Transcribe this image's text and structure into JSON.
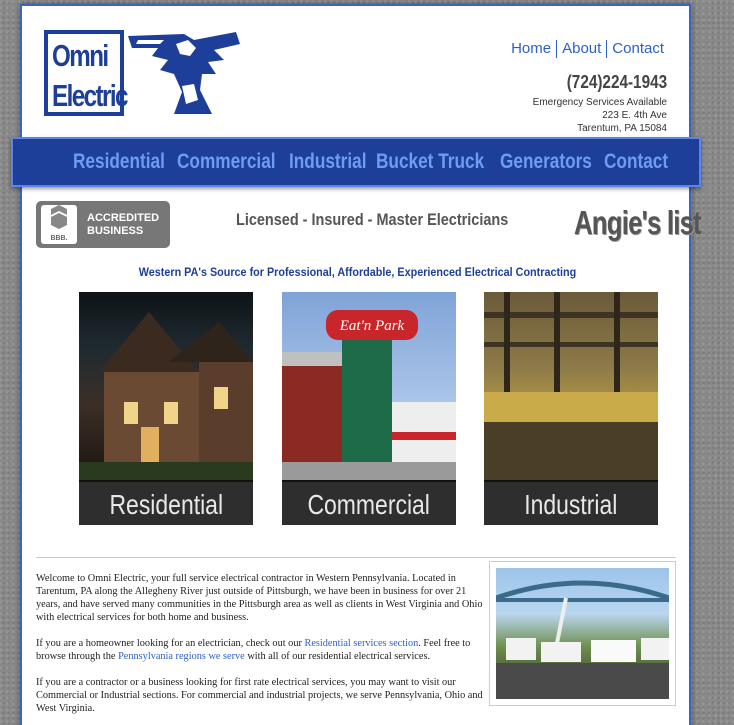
{
  "header": {
    "logo_line1": "Omni",
    "logo_line2": "Electric",
    "top_links": [
      "Home",
      "About",
      "Contact"
    ],
    "phone": "(724)224-1943",
    "address_lines": [
      "Emergency Services Available",
      "223 E. 4th Ave",
      "Tarentum, PA 15084"
    ]
  },
  "nav": {
    "items": [
      "Residential",
      "Commercial",
      "Industrial",
      "Bucket Truck",
      "Generators",
      "Contact"
    ]
  },
  "badges": {
    "bbb_seal": "BBB.",
    "bbb_line1": "ACCREDITED",
    "bbb_line2": "BUSINESS",
    "tagline": "Licensed - Insured - Master Electricians",
    "angies": "Angie's list"
  },
  "subhead": "Western PA's Source for Professional, Affordable, Experienced Electrical Contracting",
  "tiles": [
    {
      "caption": "Residential"
    },
    {
      "caption": "Commercial"
    },
    {
      "caption": "Industrial"
    }
  ],
  "commercial_sign": "Eat'n Park",
  "content": {
    "p1": "Welcome to Omni Electric, your full service electrical contractor in Western Pennsylvania. Located in Tarentum, PA along the Allegheny River just outside of Pittsburgh, we have been in business for over 21 years, and have served many communities in the Pittsburgh area as well as clients in West Virginia and Ohio with electrical services for both home and business.",
    "p2_before": "If you are a homeowner looking for an electrician, check out our ",
    "p2_link1": "Residential services section",
    "p2_middle": ". Feel free to browse through the ",
    "p2_link2": "Pennsylvania regions we serve",
    "p2_after": " with all of our residential electrical services.",
    "p3": "If you are a contractor or a business looking for first rate electrical services, you may want to visit our Commercial or Industrial sections. For commercial and industrial projects, we serve Pennsylvania, Ohio and West Virginia."
  }
}
